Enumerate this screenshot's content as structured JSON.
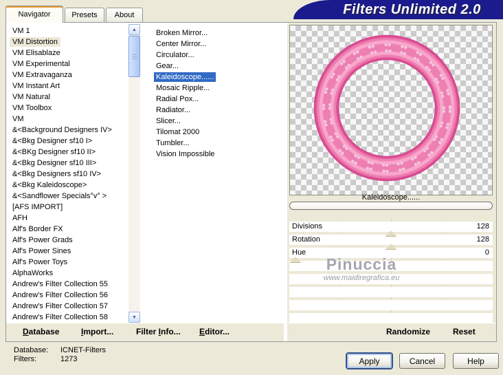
{
  "window": {
    "title": "Filters Unlimited 2.0"
  },
  "tabs": [
    {
      "label": "Navigator",
      "selected": true
    },
    {
      "label": "Presets",
      "selected": false
    },
    {
      "label": "About",
      "selected": false
    }
  ],
  "category_list": [
    {
      "label": "VM 1"
    },
    {
      "label": "VM Distortion",
      "selected": true
    },
    {
      "label": "VM Elisablaze"
    },
    {
      "label": "VM Experimental"
    },
    {
      "label": "VM Extravaganza"
    },
    {
      "label": "VM Instant Art"
    },
    {
      "label": "VM Natural"
    },
    {
      "label": "VM Toolbox"
    },
    {
      "label": "VM"
    },
    {
      "label": "&<Background Designers IV>"
    },
    {
      "label": "&<Bkg Designer sf10 I>"
    },
    {
      "label": "&<BKg Designer sf10 II>"
    },
    {
      "label": "&<Bkg Designer sf10 III>"
    },
    {
      "label": "&<Bkg Designers sf10 IV>"
    },
    {
      "label": "&<Bkg Kaleidoscope>"
    },
    {
      "label": "&<Sandflower Specials°v° >"
    },
    {
      "label": "[AFS IMPORT]"
    },
    {
      "label": "AFH"
    },
    {
      "label": "Alf's Border FX"
    },
    {
      "label": "Alf's Power Grads"
    },
    {
      "label": "Alf's Power Sines"
    },
    {
      "label": "Alf's Power Toys"
    },
    {
      "label": "AlphaWorks"
    },
    {
      "label": "Andrew's Filter Collection 55"
    },
    {
      "label": "Andrew's Filter Collection 56"
    },
    {
      "label": "Andrew's Filter Collection 57"
    },
    {
      "label": "Andrew's Filter Collection 58"
    }
  ],
  "filter_list": [
    {
      "label": "Broken Mirror..."
    },
    {
      "label": "Center Mirror..."
    },
    {
      "label": "Circulator..."
    },
    {
      "label": "Gear..."
    },
    {
      "label": "Kaleidoscope......",
      "selected": true
    },
    {
      "label": "Mosaic Ripple..."
    },
    {
      "label": "Radial Pox..."
    },
    {
      "label": "Radiator..."
    },
    {
      "label": "Slicer..."
    },
    {
      "label": "Tilomat 2000"
    },
    {
      "label": "Tumbler..."
    },
    {
      "label": "Vision Impossible"
    }
  ],
  "preview": {
    "caption": "Kaleidoscope......"
  },
  "sliders": [
    {
      "label": "Divisions",
      "value": "128",
      "pos": 0.5
    },
    {
      "label": "Rotation",
      "value": "128",
      "pos": 0.5
    },
    {
      "label": "Hue",
      "value": "0",
      "pos": 0
    }
  ],
  "watermark": {
    "name": "Pinuccia",
    "url": "www.maidiregrafica.eu"
  },
  "toolbar": [
    {
      "pre": "",
      "u": "D",
      "post": "atabase"
    },
    {
      "pre": "",
      "u": "I",
      "post": "mport..."
    },
    {
      "pre": "Filter ",
      "u": "I",
      "post": "nfo..."
    },
    {
      "pre": "",
      "u": "E",
      "post": "ditor..."
    }
  ],
  "actions": {
    "randomize": "Randomize",
    "reset": "Reset"
  },
  "status": {
    "database_label": "Database:",
    "database_value": "ICNET-Filters",
    "filters_label": "Filters:",
    "filters_value": "1273"
  },
  "buttons": {
    "apply": "Apply",
    "cancel": "Cancel",
    "help": "Help"
  },
  "colors": {
    "banner": "#1b1b8e",
    "selection_blue": "#316ac5",
    "selection_beige": "#ece9d8",
    "ring_pink": "#ee7fb2"
  }
}
